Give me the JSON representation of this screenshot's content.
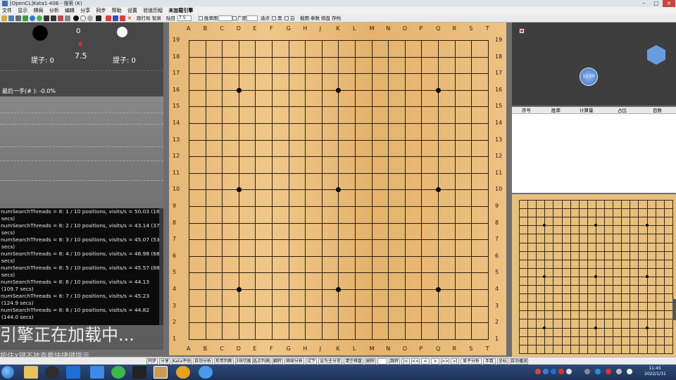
{
  "window": {
    "title": "[OpenCL]Kata1-40B - 搜索 (K)"
  },
  "menu": [
    "文件",
    "显示",
    "棋局",
    "分析",
    "编辑",
    "分享",
    "同步",
    "帮助",
    "设置",
    "验道历程",
    "未加载引擎"
  ],
  "toolbar": {
    "analyze_label": "跟打局",
    "sync_label": "智泉",
    "komi_label": "贴目",
    "komi_value": "7.5",
    "winrate_label": "胜率图",
    "breadth_label": "广度",
    "options": [
      "选点",
      "黑",
      "白",
      "截图",
      "参数",
      "棋盘",
      "存档"
    ]
  },
  "left_panel": {
    "move_number": "0",
    "komi": "7.5",
    "captures_black": "提子: 0",
    "captures_white": "提子: 0",
    "last_move": "最后一手(# ): -0.0%"
  },
  "console": {
    "lines": [
      "numSearchThreads = 8: 1 / 10 positions, visits/s = 50.03 (16.1",
      "secs)",
      "numSearchThreads = 8: 2 / 10 positions, visits/s = 43.14 (37.4",
      "secs)",
      "numSearchThreads = 8: 3 / 10 positions, visits/s = 45.07 (53.7",
      "secs)",
      "numSearchThreads = 8: 4 / 10 positions, visits/s = 46.98 (68.7",
      "secs)",
      "numSearchThreads = 8: 5 / 10 positions, visits/s = 45.57 (88.5",
      "secs)",
      "numSearchThreads = 8: 6 / 10 positions, visits/s = 44.13",
      "(109.7 secs)",
      "numSearchThreads = 8: 7 / 10 positions, visits/s = 45.23",
      "(124.9 secs)",
      "numSearchThreads = 8: 8 / 10 positions, visits/s = 44.82",
      "(144.0 secs)"
    ],
    "loading_text": "引擎正在加载中...",
    "hint_text": "按住X键不放查看快捷键提示"
  },
  "board": {
    "columns": [
      "A",
      "B",
      "C",
      "D",
      "E",
      "F",
      "G",
      "H",
      "J",
      "K",
      "L",
      "M",
      "N",
      "O",
      "P",
      "Q",
      "R",
      "S",
      "T"
    ],
    "rows": [
      "19",
      "18",
      "17",
      "16",
      "15",
      "14",
      "13",
      "12",
      "11",
      "10",
      "9",
      "8",
      "7",
      "6",
      "5",
      "4",
      "3",
      "2",
      "1"
    ],
    "star_points": [
      "D16",
      "K16",
      "Q16",
      "D10",
      "K10",
      "Q10",
      "D4",
      "K4",
      "Q4"
    ]
  },
  "right_panel": {
    "clock_label": "12:59",
    "table_headers": [
      "序号",
      "胜率",
      "计算量",
      "占比",
      "目数"
    ]
  },
  "bottom_buttons": [
    "同步",
    "分享",
    "Kata评估",
    "自动分析",
    "形势判断",
    "3块切换",
    "选点列表",
    "翻转",
    "继续分析",
    "试下",
    "设为主分支",
    "清空棋盘",
    "删除",
    "",
    "跳转",
    "|<",
    "<<",
    "<",
    ">",
    ">>",
    ">|",
    "显子分析",
    "手数",
    "坐标",
    "自动播放"
  ],
  "taskbar": {
    "time": "11:45",
    "date": "2022/1/31"
  },
  "colors": {
    "board": "#eebf80",
    "panel": "#474747",
    "console_bg": "#0b0b0b",
    "taskbar": "#1d3358"
  }
}
